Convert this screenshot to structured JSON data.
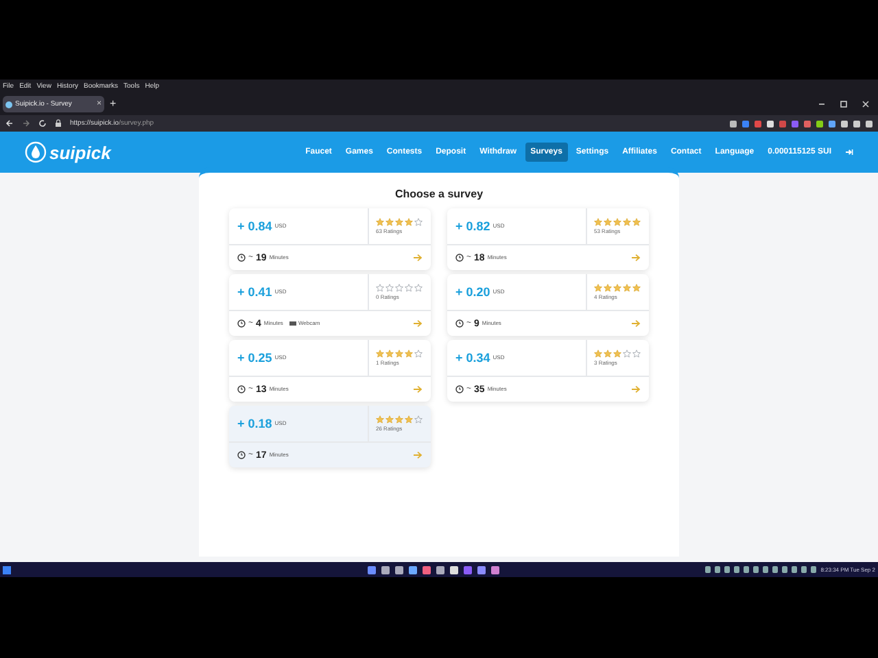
{
  "browser": {
    "menu": [
      "File",
      "Edit",
      "View",
      "History",
      "Bookmarks",
      "Tools",
      "Help"
    ],
    "tab": {
      "title": "Suipick.io - Survey",
      "close": "×"
    },
    "new_tab": "+",
    "url": {
      "host": "https://suipick.io",
      "path": "/survey.php"
    }
  },
  "site": {
    "logo": "suipick",
    "nav": [
      {
        "label": "Faucet",
        "selected": false
      },
      {
        "label": "Games",
        "selected": false
      },
      {
        "label": "Contests",
        "selected": false
      },
      {
        "label": "Deposit",
        "selected": false
      },
      {
        "label": "Withdraw",
        "selected": false
      },
      {
        "label": "Surveys",
        "selected": true
      },
      {
        "label": "Settings",
        "selected": false
      },
      {
        "label": "Affiliates",
        "selected": false
      },
      {
        "label": "Contact",
        "selected": false
      },
      {
        "label": "Language",
        "selected": false
      }
    ],
    "balance": "0.000115125 SUI"
  },
  "heading": "Choose a survey",
  "surveys": [
    {
      "amount": "+ 0.84",
      "currency": "USD",
      "stars": 4,
      "ratings": "63 Ratings",
      "approx": "~",
      "minutes": "19",
      "unit": "Minutes",
      "highlighted": false
    },
    {
      "amount": "+ 0.82",
      "currency": "USD",
      "stars": 5,
      "ratings": "53 Ratings",
      "approx": "~",
      "minutes": "18",
      "unit": "Minutes",
      "highlighted": false
    },
    {
      "amount": "+ 0.41",
      "currency": "USD",
      "stars": 0,
      "ratings": "0 Ratings",
      "approx": "~",
      "minutes": "4",
      "unit": "Minutes",
      "tag": "Webcam",
      "highlighted": false
    },
    {
      "amount": "+ 0.20",
      "currency": "USD",
      "stars": 5,
      "ratings": "4 Ratings",
      "approx": "~",
      "minutes": "9",
      "unit": "Minutes",
      "highlighted": false
    },
    {
      "amount": "+ 0.25",
      "currency": "USD",
      "stars": 4,
      "ratings": "1 Ratings",
      "approx": "~",
      "minutes": "13",
      "unit": "Minutes",
      "highlighted": false
    },
    {
      "amount": "+ 0.34",
      "currency": "USD",
      "stars": 3,
      "ratings": "3 Ratings",
      "approx": "~",
      "minutes": "35",
      "unit": "Minutes",
      "highlighted": false
    },
    {
      "amount": "+ 0.18",
      "currency": "USD",
      "stars": 4,
      "ratings": "26 Ratings",
      "approx": "~",
      "minutes": "17",
      "unit": "Minutes",
      "highlighted": true
    }
  ],
  "taskbar": {
    "clock": "8:23:34 PM Tue Sep 2"
  }
}
